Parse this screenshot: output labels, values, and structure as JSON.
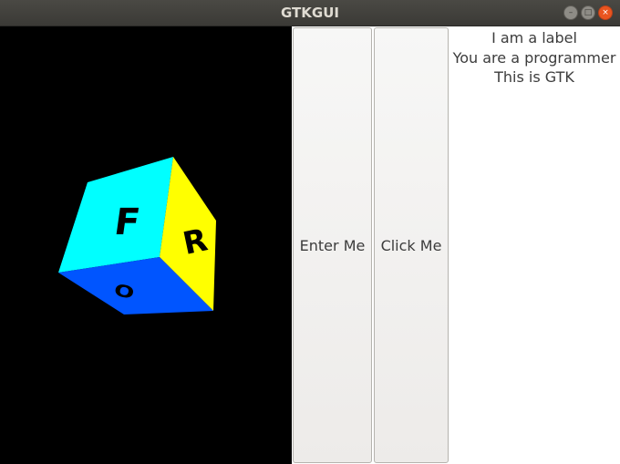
{
  "window": {
    "title": "GTKGUI",
    "controls": {
      "minimize": "–",
      "maximize": "□",
      "close": "×"
    }
  },
  "cube": {
    "faces": [
      {
        "letter": "F",
        "color": "#00ffff"
      },
      {
        "letter": "R",
        "color": "#ffff00"
      },
      {
        "letter": "O",
        "color": "#0055ff"
      }
    ]
  },
  "buttons": {
    "enter_label": "Enter Me",
    "click_label": "Click Me"
  },
  "labels": {
    "line1": "I am a label",
    "line2": "You are a programmer",
    "line3": "This is GTK"
  }
}
